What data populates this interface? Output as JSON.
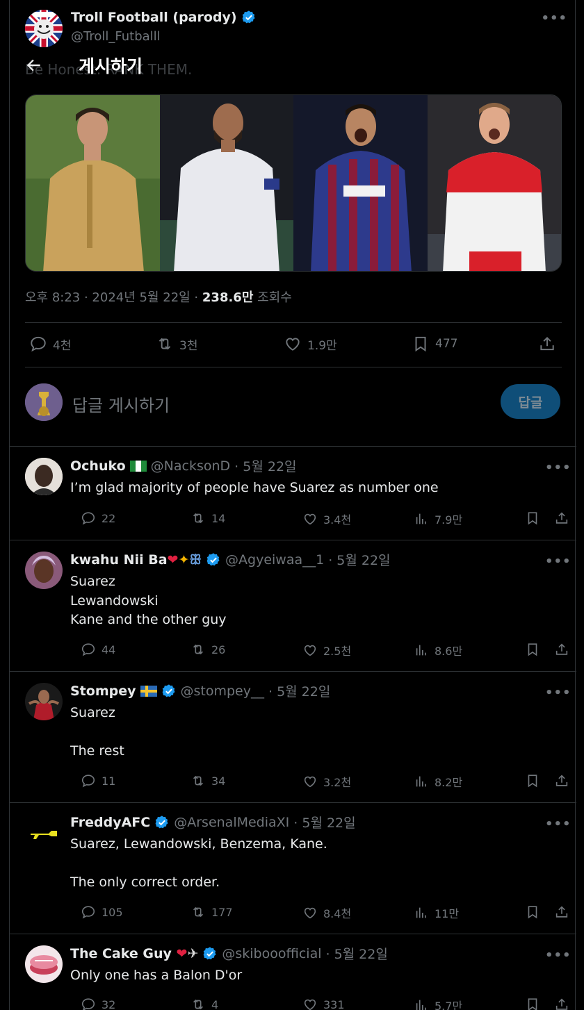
{
  "header": {
    "title": "게시하기"
  },
  "tweet": {
    "author_name": "Troll Football (parody)",
    "author_handle": "@Troll_Futballl",
    "text": "Be Honest. RANK THEM.",
    "time": "오후 8:23 · 2024년 5월 22일 · ",
    "views": "238.6만",
    "views_label": " 조회수",
    "stats": {
      "replies": "4천",
      "retweets": "3천",
      "likes": "1.9만",
      "bookmarks": "477"
    }
  },
  "compose": {
    "placeholder": "답글 게시하기",
    "button": "답글"
  },
  "colors": {
    "verified": "#1d9bf0",
    "background": "#000000",
    "muted": "#71767b",
    "reply_button": "#0f4e78"
  },
  "replies": [
    {
      "name": "Ochuko",
      "handle": "@NacksonD",
      "date": "· 5월 22일",
      "text": "I’m glad majority of people have Suarez as number one",
      "stats": [
        "22",
        "14",
        "3.4천",
        "7.9만"
      ]
    },
    {
      "name": "kwahu Nii Ba",
      "handle": "@Agyeiwaa__1",
      "date": "· 5월 22일",
      "text": "Suarez\nLewandowski\nKane and the other guy",
      "stats": [
        "44",
        "26",
        "2.5천",
        "8.6만"
      ]
    },
    {
      "name": "Stompey",
      "handle": "@stompey__",
      "date": "· 5월 22일",
      "text": "Suarez\n\nThe rest",
      "stats": [
        "11",
        "34",
        "3.2천",
        "8.2만"
      ]
    },
    {
      "name": "FreddyAFC",
      "handle": "@ArsenalMediaXI",
      "date": "· 5월 22일",
      "text": "Suarez, Lewandowski, Benzema, Kane.\n\nThe only correct order.",
      "stats": [
        "105",
        "177",
        "8.4천",
        "11만"
      ]
    },
    {
      "name": "The Cake Guy",
      "handle": "@skibooofficial",
      "date": "· 5월 22일",
      "text": "Only one has a Balon D'or",
      "stats": [
        "32",
        "4",
        "331",
        "5.7만"
      ]
    }
  ]
}
